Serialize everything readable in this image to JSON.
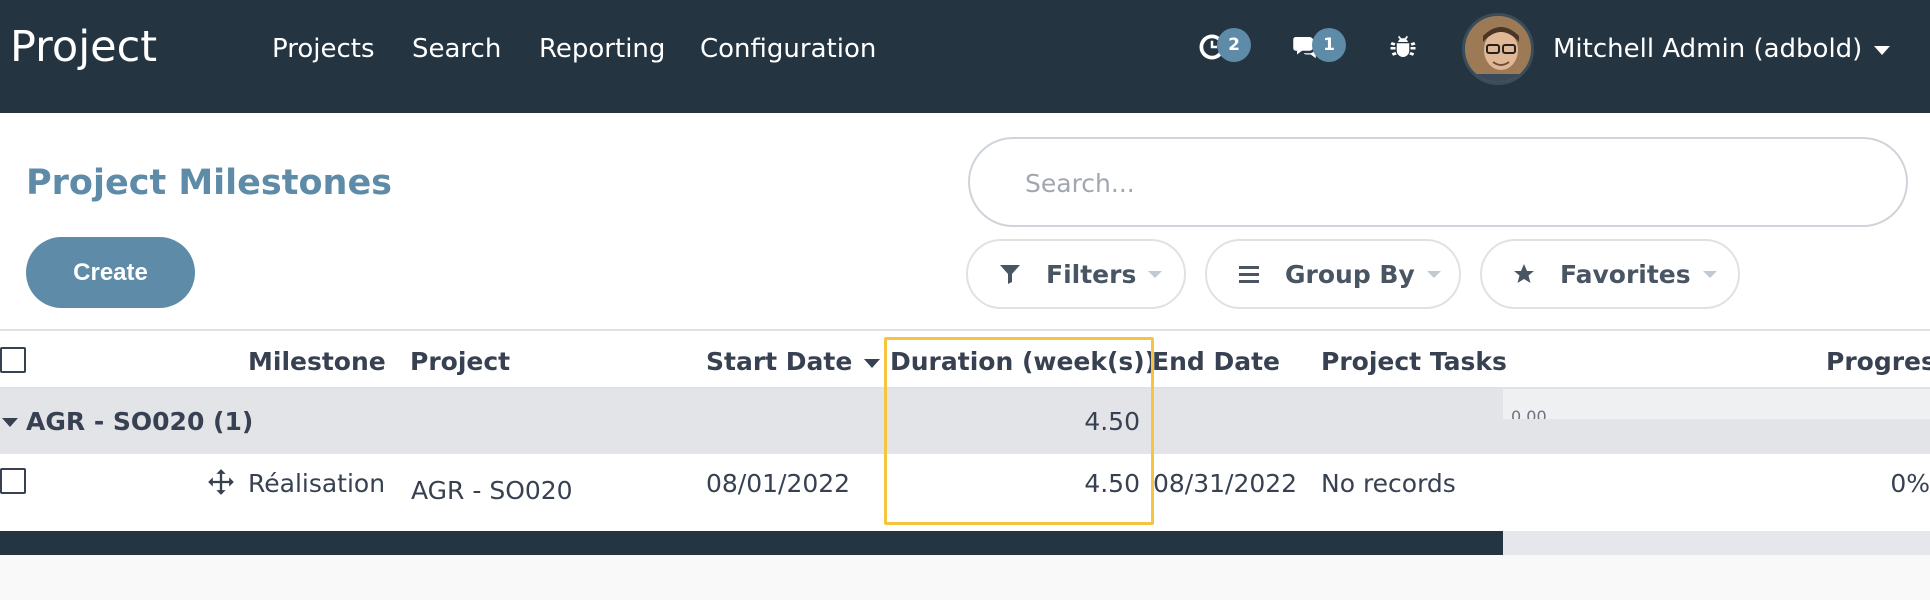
{
  "navbar": {
    "brand": "Project",
    "menu": [
      "Projects",
      "Search",
      "Reporting",
      "Configuration"
    ],
    "activities_count": "2",
    "messages_count": "1",
    "user_name": "Mitchell Admin (adbold)"
  },
  "control_panel": {
    "title": "Project Milestones",
    "create_label": "Create",
    "search_placeholder": "Search...",
    "filters_label": "Filters",
    "group_by_label": "Group By",
    "favorites_label": "Favorites"
  },
  "table": {
    "columns": [
      "Milestone",
      "Project",
      "Start Date",
      "Duration (week(s))",
      "End Date",
      "Project Tasks",
      "Progress"
    ],
    "sorted_column": "Start Date",
    "group": {
      "label": "AGR - SO020 (1)",
      "duration": "4.50",
      "progress": "0.00"
    },
    "rows": [
      {
        "milestone": "Réalisation",
        "project": "AGR - SO020",
        "start_date": "08/01/2022",
        "duration": "4.50",
        "end_date": "08/31/2022",
        "project_tasks": "No records",
        "progress": "0%"
      }
    ]
  },
  "colors": {
    "navbar_bg": "#243441",
    "accent": "#5d8ba8",
    "highlight": "#f5c542",
    "group_row_bg": "#e2e4e8"
  }
}
